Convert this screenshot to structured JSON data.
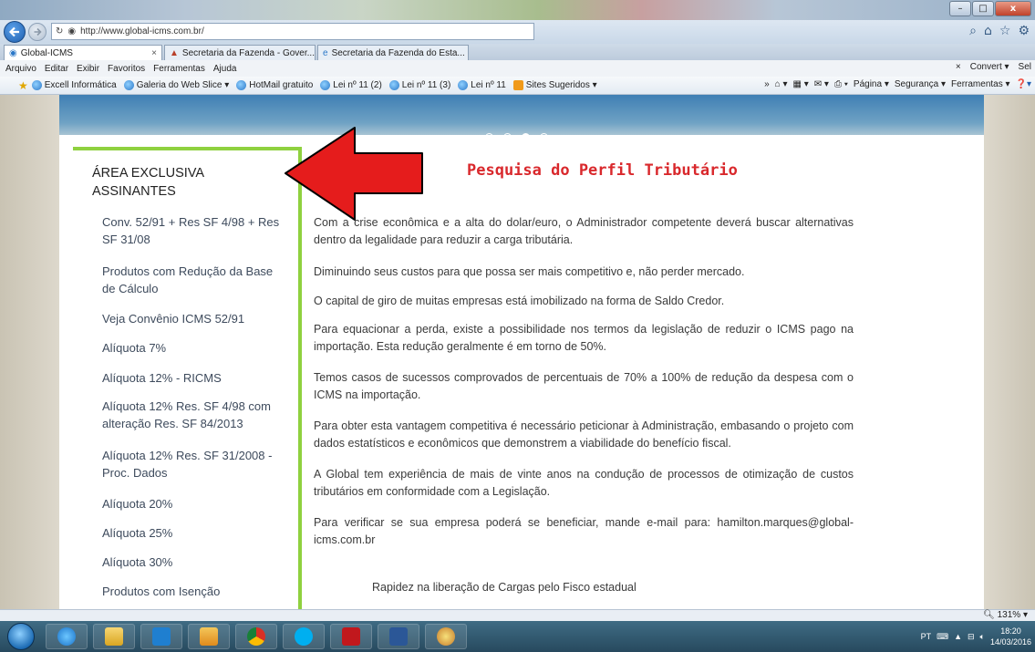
{
  "browser": {
    "window_controls": {
      "minimize": "–",
      "maximize": "□",
      "close": "x"
    },
    "address": {
      "url": "http://www.global-icms.com.br/"
    },
    "tabs": [
      {
        "label": "Global-ICMS",
        "close": "×"
      },
      {
        "label": "Secretaria da Fazenda - Gover..."
      },
      {
        "label": "Secretaria da Fazenda do Esta..."
      }
    ],
    "menu": [
      "Arquivo",
      "Editar",
      "Exibir",
      "Favoritos",
      "Ferramentas",
      "Ajuda"
    ],
    "menu_right": {
      "close": "×",
      "convert": "Convert ▾",
      "select": "Sel"
    },
    "favorites": [
      "Excell Informática",
      "Galeria do Web Slice ▾",
      "HotMail gratuito",
      "Lei nº 11 (2)",
      "Lei nº 11 (3)",
      "Lei nº 11",
      "Sites Sugeridos ▾"
    ],
    "favorites_overflow": "»",
    "toolbar_right": [
      "Página ▾",
      "Segurança ▾",
      "Ferramentas ▾"
    ],
    "zoom": "131%"
  },
  "page": {
    "sidebar": {
      "title": "ÁREA EXCLUSIVA ASSINANTES",
      "links": [
        "Conv. 52/91 + Res SF 4/98 + Res SF 31/08",
        "Produtos com Redução da Base de Cálculo",
        "Veja Convênio ICMS 52/91",
        "Alíquota 7%",
        "Alíquota 12% - RICMS",
        "Alíquota 12% Res. SF 4/98 com alteração Res. SF 84/2013",
        "Alíquota 12% Res. SF 31/2008 - Proc. Dados",
        "Alíquota 20%",
        "Alíquota 25%",
        "Alíquota 30%",
        "Produtos com Isenção"
      ]
    },
    "content": {
      "title": "Pesquisa do Perfil Tributário",
      "paragraphs": [
        "Com a crise econômica e a alta do dolar/euro, o Administrador competente deverá buscar alternativas dentro da legalidade para reduzir a carga tributária.",
        "Diminuindo seus custos para que possa ser mais competitivo e, não perder mercado.",
        "O capital de giro de muitas empresas está imobilizado na forma de Saldo Credor.",
        "Para equacionar a perda, existe a possibilidade nos termos da legislação de reduzir o ICMS pago na importação. Esta redução geralmente é em torno de 50%.",
        "Temos casos de sucessos comprovados de percentuais de 70% a 100% de redução da despesa com o ICMS na importação.",
        "Para obter esta vantagem competitiva é necessário peticionar à Administração, embasando o projeto com dados estatísticos e econômicos que demonstrem a viabilidade do benefício fiscal.",
        "A Global tem experiência de mais de vinte anos na condução de processos de otimização de custos tributários em conformidade com a Legislação.",
        "Para verificar se sua empresa poderá se beneficiar, mande e-mail para: hamilton.marques@global-icms.com.br"
      ],
      "caption": "Rapidez na liberação de Cargas pelo Fisco estadual"
    }
  },
  "taskbar": {
    "language": "PT",
    "time": "18:20",
    "date": "14/03/2016"
  },
  "colors": {
    "accent_green": "#8fd13f",
    "title_red": "#d9282c",
    "arrow_red": "#e51c1c"
  }
}
